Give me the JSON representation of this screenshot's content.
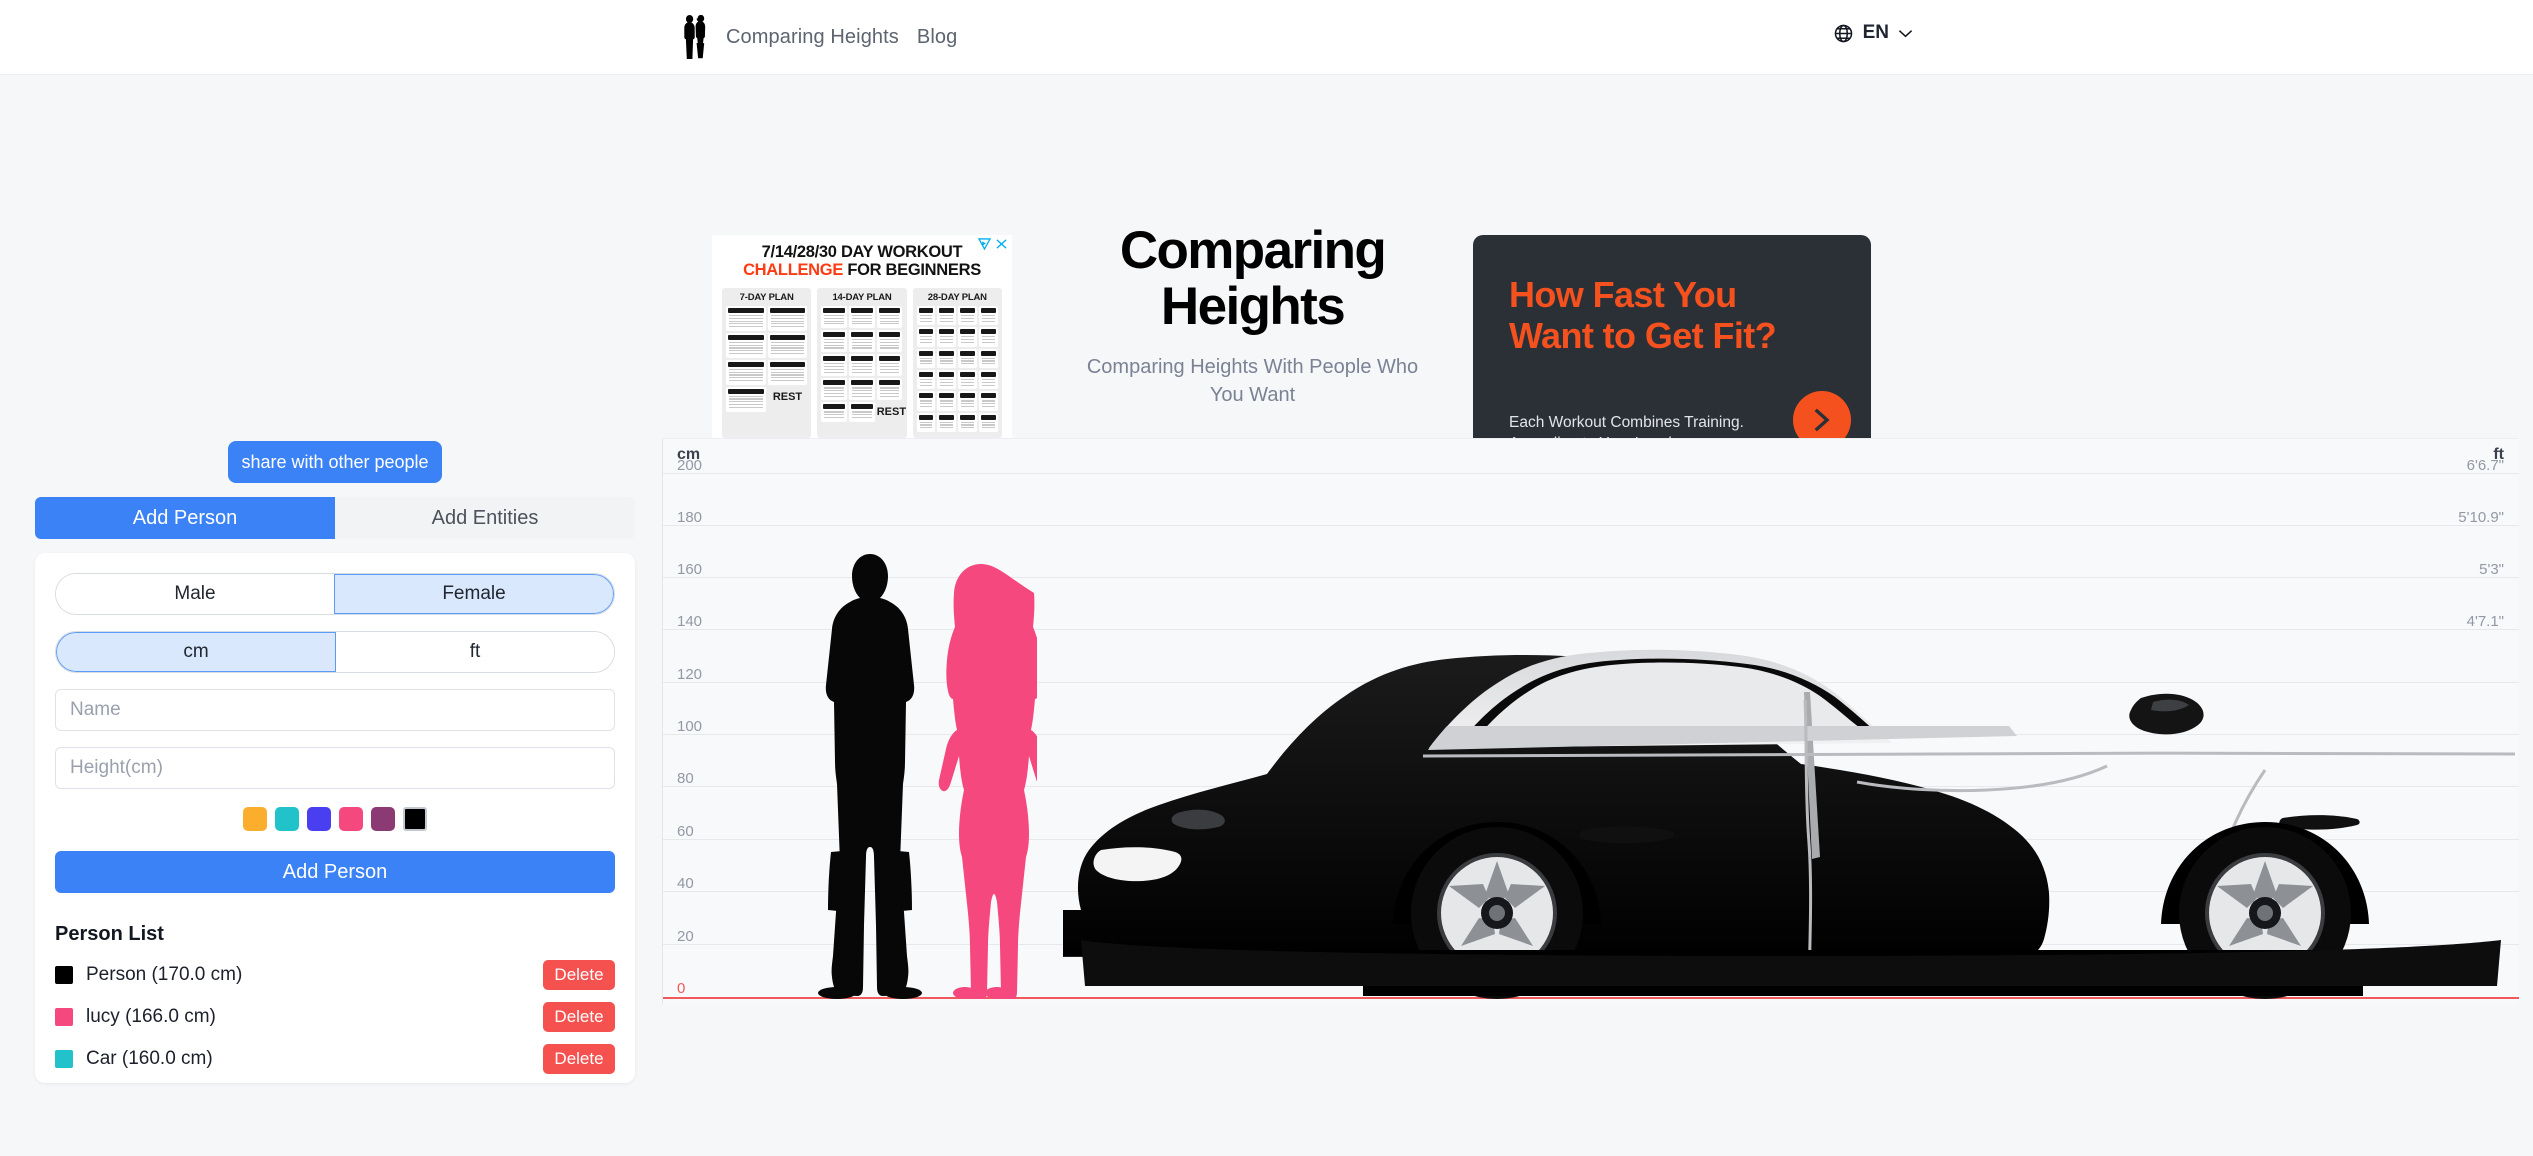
{
  "header": {
    "logo_alt": "two-people-logo",
    "nav": [
      {
        "label": "Comparing Heights"
      },
      {
        "label": "Blog"
      }
    ],
    "language": {
      "code": "EN"
    }
  },
  "hero": {
    "title_line1": "Comparing",
    "title_line2": "Heights",
    "subtitle": "Comparing Heights With People Who You Want"
  },
  "ad_left": {
    "headline_1": "7/14/28/30 DAY WORKOUT",
    "headline_2a": "CHALLENGE",
    "headline_2b": " FOR BEGINNERS",
    "plans": [
      {
        "title": "7-DAY PLAN",
        "rest": "REST"
      },
      {
        "title": "14-DAY PLAN",
        "rest": "REST"
      },
      {
        "title": "28-DAY PLAN",
        "rest": ""
      }
    ],
    "adchoices_icon": "adchoices-triangle-icon",
    "close_icon": "close-icon"
  },
  "ad_right": {
    "headline": "How Fast You Want to Get Fit?",
    "body": "Each Workout Combines Training. According to Your Level",
    "cta_icon": "chevron-right-icon",
    "accent": "#f4511e",
    "background": "#2b3036"
  },
  "controls": {
    "share_label": "share with other people",
    "tabs": [
      {
        "label": "Add Person",
        "active": true
      },
      {
        "label": "Add Entities",
        "active": false
      }
    ],
    "gender": {
      "options": [
        "Male",
        "Female"
      ],
      "selected": "Female"
    },
    "units": {
      "options": [
        "cm",
        "ft"
      ],
      "selected": "cm"
    },
    "name_placeholder": "Name",
    "name_value": "",
    "height_placeholder": "Height(cm)",
    "height_value": "",
    "colors": [
      {
        "name": "orange",
        "hex": "#fbad2d",
        "selected": false
      },
      {
        "name": "teal",
        "hex": "#21c2c9",
        "selected": false
      },
      {
        "name": "indigo",
        "hex": "#4a3ff0",
        "selected": false
      },
      {
        "name": "pink",
        "hex": "#f5487f",
        "selected": false
      },
      {
        "name": "plum",
        "hex": "#8c3a74",
        "selected": false
      },
      {
        "name": "black",
        "hex": "#000000",
        "selected": true
      }
    ],
    "add_label": "Add Person"
  },
  "person_list": {
    "title": "Person List",
    "delete_label": "Delete",
    "items": [
      {
        "label": "Person (170.0 cm)",
        "color": "#000000",
        "delete": "Delete"
      },
      {
        "label": "lucy (166.0 cm)",
        "color": "#f5487f",
        "delete": "Delete"
      },
      {
        "label": "Car (160.0 cm)",
        "color": "#21c2c9",
        "delete": "Delete"
      }
    ]
  },
  "chart_data": {
    "type": "bar",
    "title": "",
    "unit_left": "cm",
    "unit_right": "ft",
    "ylim": [
      0,
      210
    ],
    "yticks_cm": [
      200,
      180,
      160,
      140,
      120,
      100,
      80,
      60,
      40,
      20,
      0
    ],
    "yticks_ft": [
      "6'6.7\"",
      "5'10.9\"",
      "5'3\"",
      "4'7.1\"",
      "",
      "",
      "",
      "",
      "",
      "",
      ""
    ],
    "grid": true,
    "baseline_color": "#f05a5a",
    "zero_label_color": "#f05a5a",
    "categories": [
      "Person",
      "lucy",
      "Car"
    ],
    "values": [
      170.0,
      166.0,
      160.0
    ],
    "series": [
      {
        "name": "entities",
        "items": [
          {
            "label": "Person",
            "height_cm": 170.0,
            "color": "#000000",
            "kind": "male-silhouette"
          },
          {
            "label": "lucy",
            "height_cm": 166.0,
            "color": "#f5487f",
            "kind": "female-silhouette"
          },
          {
            "label": "Car",
            "height_cm": 160.0,
            "color": "#141414",
            "kind": "car-illustration"
          }
        ]
      }
    ],
    "xlabel": "",
    "ylabel": "cm",
    "legend": "none"
  }
}
